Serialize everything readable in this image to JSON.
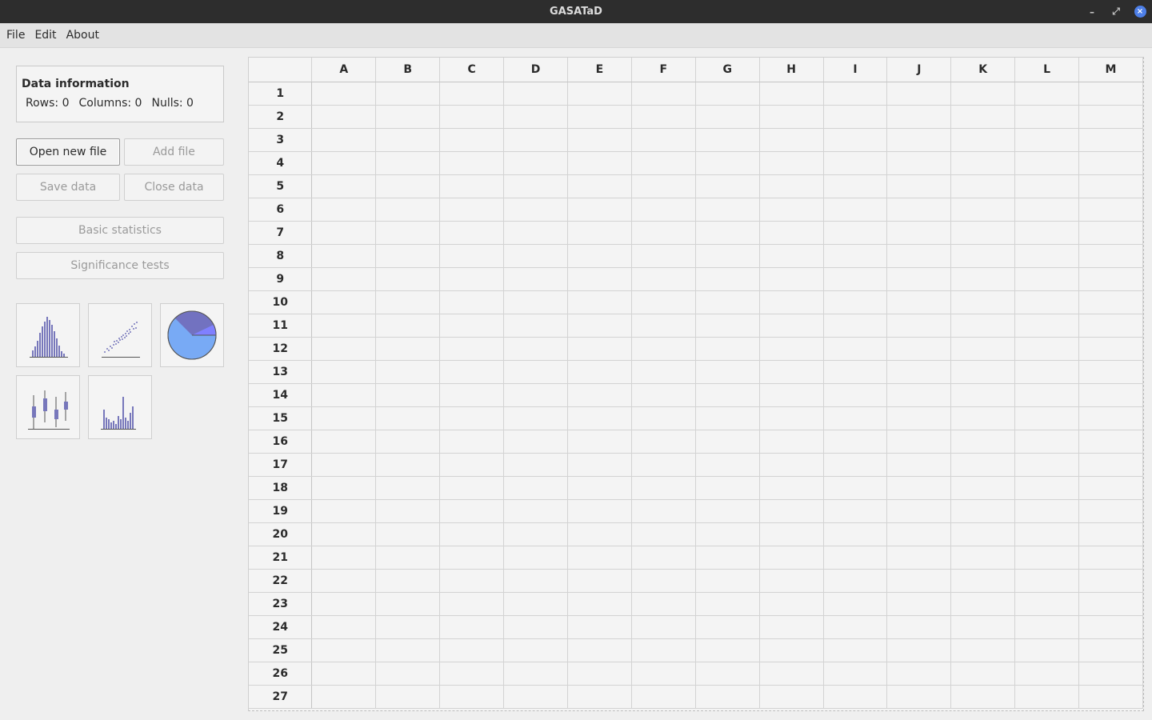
{
  "window": {
    "title": "GASATaD",
    "minimize_glyph": "–",
    "maximize_glyph": "⤢",
    "close_glyph": "×"
  },
  "menu": {
    "items": [
      {
        "label": "File"
      },
      {
        "label": "Edit"
      },
      {
        "label": "About"
      }
    ]
  },
  "data_info": {
    "title": "Data information",
    "rows": "Rows: 0",
    "columns": "Columns: 0",
    "nulls": "Nulls: 0"
  },
  "buttons": {
    "open_new_file": "Open new file",
    "add_file": "Add file",
    "save_data": "Save data",
    "close_data": "Close data",
    "basic_statistics": "Basic statistics",
    "significance_tests": "Significance tests"
  },
  "chart_icons": [
    {
      "icon": "histogram-icon"
    },
    {
      "icon": "scatter-plot-icon"
    },
    {
      "icon": "pie-chart-icon"
    },
    {
      "icon": "box-plot-icon"
    },
    {
      "icon": "bar-chart-icon"
    }
  ],
  "colors": {
    "icon_fill": "#7777bb",
    "pie_main": "#78aaf5",
    "pie_dark": "#7272c0",
    "pie_light": "#8080ff",
    "close_button": "#4d7fe8"
  },
  "grid": {
    "columns": [
      "A",
      "B",
      "C",
      "D",
      "E",
      "F",
      "G",
      "H",
      "I",
      "J",
      "K",
      "L",
      "M"
    ],
    "rows": [
      "1",
      "2",
      "3",
      "4",
      "5",
      "6",
      "7",
      "8",
      "9",
      "10",
      "11",
      "12",
      "13",
      "14",
      "15",
      "16",
      "17",
      "18",
      "19",
      "20",
      "21",
      "22",
      "23",
      "24",
      "25",
      "26",
      "27"
    ]
  }
}
